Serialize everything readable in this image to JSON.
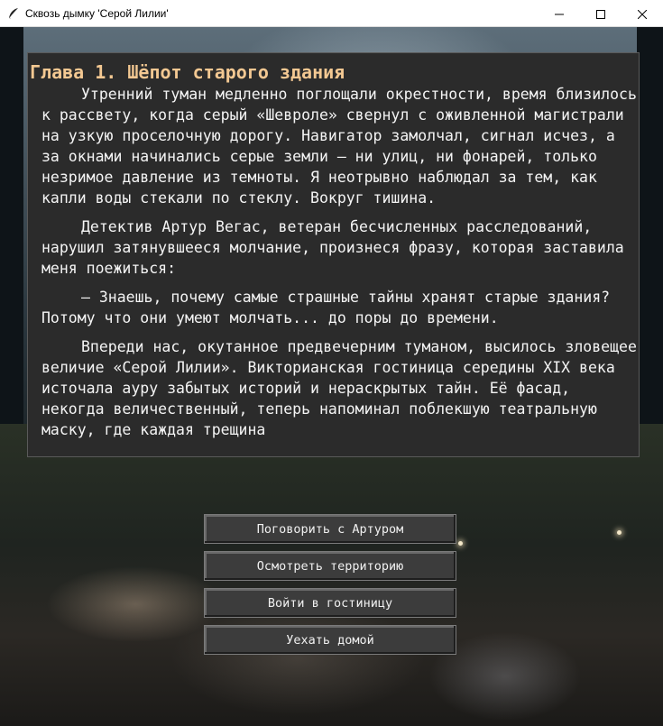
{
  "window": {
    "title": "Сквозь дымку 'Серой Лилии'",
    "icons": {
      "app": "feather-icon",
      "minimize": "minimize-icon",
      "maximize": "maximize-icon",
      "close": "close-icon"
    }
  },
  "story": {
    "chapter_title": "Глава 1. Шёпот старого здания",
    "paragraphs": [
      "Утренний туман медленно поглощали окрестности, время близилось к рассвету, когда серый «Шевроле» свернул с оживленной магистрали на узкую проселочную дорогу. Навигатор замолчал, сигнал исчез, а за окнами начинались серые земли — ни улиц, ни фонарей, только незримое давление из темноты. Я неотрывно наблюдал за тем, как капли воды стекали по стеклу. Вокруг тишина.",
      "Детектив Артур Вегас, ветеран бесчисленных расследований, нарушил затянувшееся молчание, произнеся фразу, которая заставила меня поежиться:",
      "— Знаешь, почему самые страшные тайны хранят старые здания? Потому что они умеют молчать... до поры до времени.",
      "Впереди нас, окутанное предвечерним туманом, высилось зловещее величие «Серой Лилии». Викторианская гостиница середины XIX века источала ауру забытых историй и нераскрытых тайн. Её фасад, некогда величественный, теперь напоминал поблекшую театральную маску, где каждая трещина"
    ]
  },
  "actions": [
    {
      "label": "Поговорить с Артуром"
    },
    {
      "label": "Осмотреть территорию"
    },
    {
      "label": "Войти в гостиницу"
    },
    {
      "label": "Уехать домой"
    }
  ],
  "colors": {
    "panel_bg": "#2b2b2b",
    "title_color": "#f3c892",
    "text_color": "#f4f4f4",
    "button_bg": "#3c3c3c"
  }
}
